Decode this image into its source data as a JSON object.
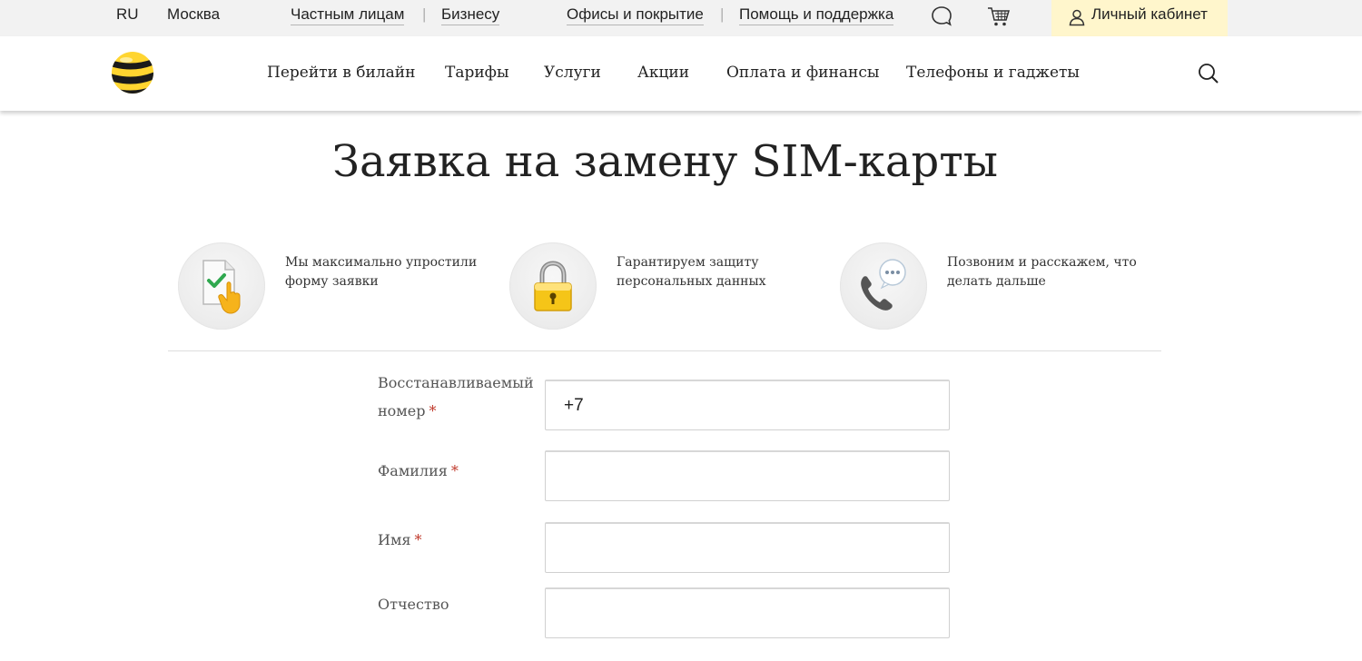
{
  "topbar": {
    "lang": "RU",
    "city": "Москва",
    "segment_private": "Частным лицам",
    "segment_business": "Бизнесу",
    "offices": "Офисы и покрытие",
    "help": "Помощь и поддержка",
    "cabinet": "Личный кабинет",
    "separator": "|"
  },
  "nav": {
    "items": [
      "Перейти в билайн",
      "Тарифы",
      "Услуги",
      "Акции",
      "Оплата и финансы",
      "Телефоны и гаджеты"
    ]
  },
  "page": {
    "title": "Заявка на замену SIM-карты"
  },
  "features": [
    {
      "icon": "document-check-icon",
      "text": "Мы максимально упростили форму заявки"
    },
    {
      "icon": "padlock-icon",
      "text": "Гарантируем защиту персональных данных"
    },
    {
      "icon": "phone-chat-icon",
      "text": "Позвоним и расскажем, что делать дальше"
    }
  ],
  "form": {
    "required_mark": "*",
    "fields": [
      {
        "label": "Восстанавливаемый номер",
        "value": "+7",
        "required": true
      },
      {
        "label": "Фамилия",
        "value": "",
        "required": true
      },
      {
        "label": "Имя",
        "value": "",
        "required": true
      },
      {
        "label": "Отчество",
        "value": "",
        "required": false
      }
    ]
  },
  "colors": {
    "brand_yellow": "#ffd530",
    "topbar_bg": "#f2f2f2",
    "cabinet_bg": "#fff6cc",
    "required_red": "#c0392b"
  }
}
